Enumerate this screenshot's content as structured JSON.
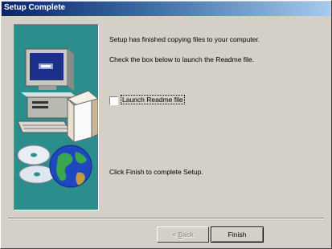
{
  "window": {
    "title": "Setup Complete"
  },
  "content": {
    "line1": "Setup has finished copying files to your computer.",
    "line2": "Check the box below to launch the Readme file.",
    "checkbox_label": "Launch Readme file",
    "checkbox_checked": false,
    "line3": "Click Finish to complete Setup."
  },
  "buttons": {
    "back_prefix": "< ",
    "back_accel": "B",
    "back_rest": "ack",
    "back_enabled": false,
    "finish": "Finish"
  },
  "colors": {
    "title_start": "#0a246a",
    "title_end": "#a6caf0",
    "art_bg": "#2b8e8c",
    "face": "#d4d0c8"
  },
  "icons": [
    "computer-monitor-illustration",
    "software-box-illustration",
    "cd-disc-illustration",
    "globe-illustration"
  ]
}
